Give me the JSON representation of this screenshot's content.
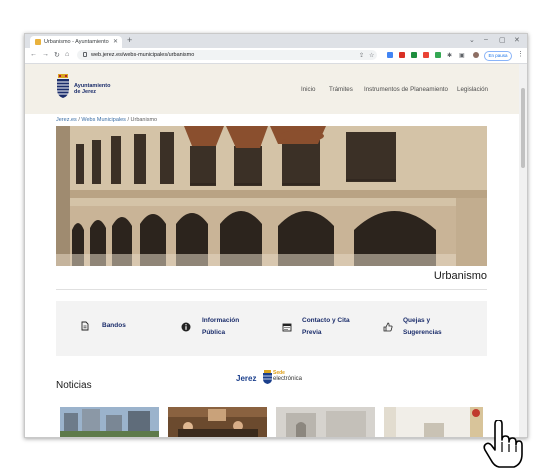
{
  "browser": {
    "tab_title": "Urbanismo - Ayuntamiento de Je",
    "url": "web.jerez.es/webs-municipales/urbanismo",
    "profile_label": "En pausa"
  },
  "site": {
    "logo_line1": "Ayuntamiento",
    "logo_line2": "de Jerez",
    "nav": [
      "Inicio",
      "Trámites",
      "Instrumentos de Planeamiento",
      "Legislación"
    ],
    "breadcrumb": [
      "Jerez.es",
      "Webs Municipales",
      "Urbanismo"
    ],
    "page_title": "Urbanismo",
    "quick_links": [
      {
        "icon": "document-icon",
        "line1": "Bandos",
        "line2": ""
      },
      {
        "icon": "info-icon",
        "line1": "Información",
        "line2": "Pública"
      },
      {
        "icon": "calendar-icon",
        "line1": "Contacto y Cita",
        "line2": "Previa"
      },
      {
        "icon": "thumbs-up-icon",
        "line1": "Quejas y",
        "line2": "Sugerencias"
      }
    ],
    "sede": {
      "brand": "Jerez",
      "word1": "Sede",
      "word2": "electrónica"
    },
    "news_heading": "Noticias"
  },
  "colors": {
    "brand_navy": "#1b2d6b",
    "header_bg": "#f3f0e8",
    "link": "#3a6ea5"
  }
}
